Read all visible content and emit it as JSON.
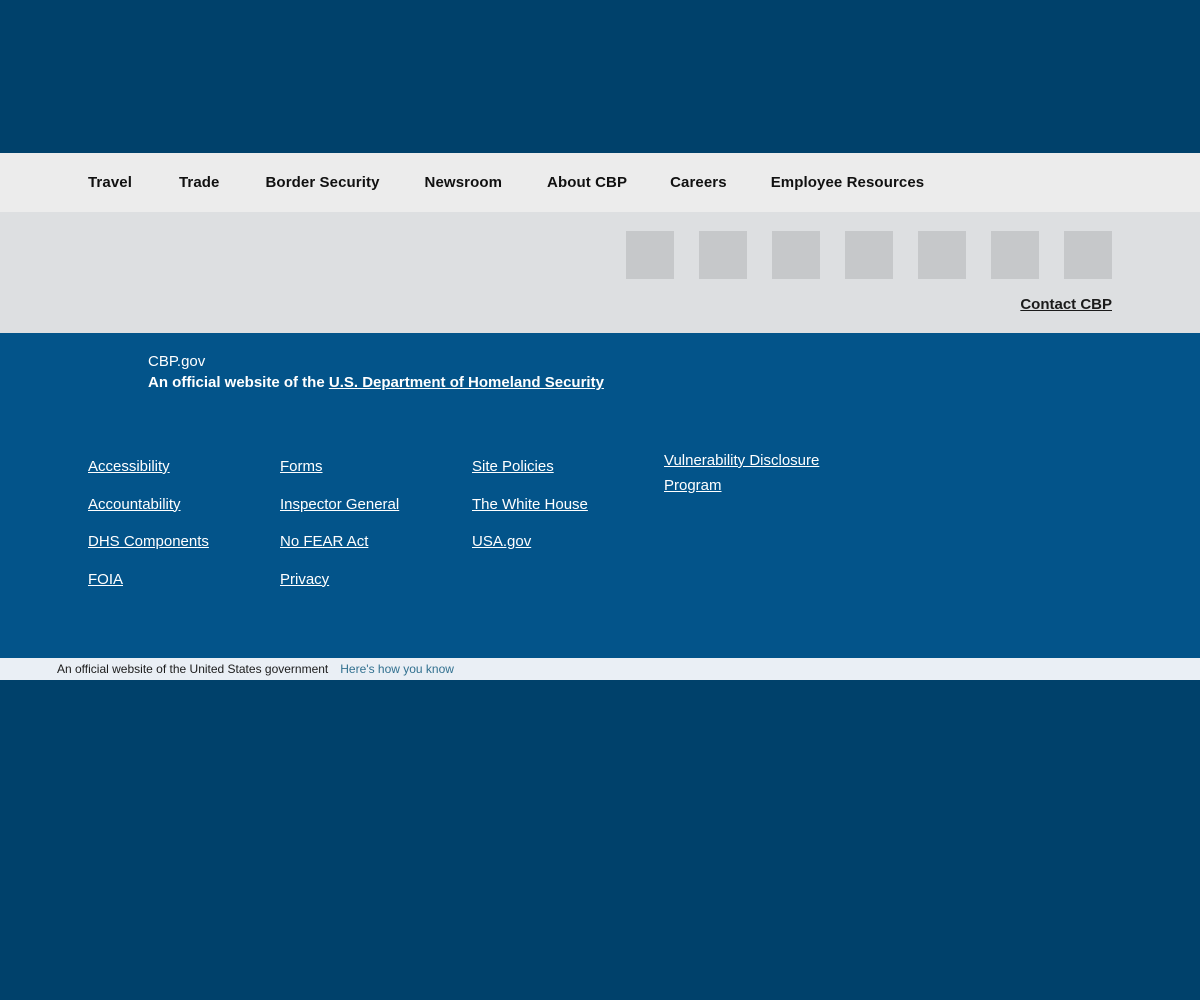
{
  "colors": {
    "navy": "#00416b",
    "nav_bg": "#ececec",
    "utility_bg": "#dddfe1",
    "footer_blue": "#03548a",
    "banner_bg": "#eaeff5",
    "banner_link": "#31708f",
    "social_placeholder": "#c6c8ca"
  },
  "primary_nav": {
    "items": [
      {
        "label": "Travel",
        "name": "travel"
      },
      {
        "label": "Trade",
        "name": "trade"
      },
      {
        "label": "Border Security",
        "name": "border-security"
      },
      {
        "label": "Newsroom",
        "name": "newsroom"
      },
      {
        "label": "About CBP",
        "name": "about-cbp"
      },
      {
        "label": "Careers",
        "name": "careers"
      },
      {
        "label": "Employee Resources",
        "name": "employee-resources"
      }
    ]
  },
  "utility": {
    "social_icons": [
      {
        "name": "social-icon-1"
      },
      {
        "name": "social-icon-2"
      },
      {
        "name": "social-icon-3"
      },
      {
        "name": "social-icon-4"
      },
      {
        "name": "social-icon-5"
      },
      {
        "name": "social-icon-6"
      },
      {
        "name": "social-icon-7"
      }
    ],
    "contact_label": "Contact CBP"
  },
  "footer": {
    "site_name": "CBP.gov",
    "official_prefix": "An official website of the ",
    "dhs_link": "U.S. Department of Homeland Security",
    "columns": [
      {
        "links": [
          "Accessibility",
          "Accountability",
          "DHS Components",
          "FOIA"
        ]
      },
      {
        "links": [
          "Forms",
          "Inspector General",
          "No FEAR Act",
          "Privacy"
        ]
      },
      {
        "links": [
          "Site Policies",
          "The White House",
          "USA.gov"
        ]
      },
      {
        "links": [
          "Vulnerability Disclosure Program"
        ]
      }
    ]
  },
  "gov_banner": {
    "text": "An official website of the United States government",
    "link": "Here's how you know"
  }
}
